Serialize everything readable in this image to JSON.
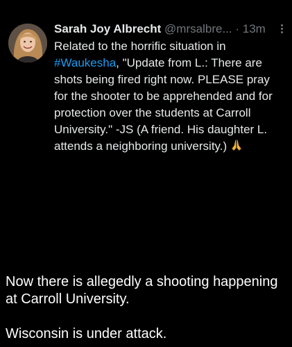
{
  "tweet": {
    "display_name": "Sarah Joy Albrecht",
    "handle": "@mrsalbre...",
    "separator": "·",
    "timestamp": "13m",
    "text_before_hashtag": "Related to the horrific situation in ",
    "hashtag": "#Waukesha",
    "text_after_hashtag": ", \"Update from L.: There are shots being fired right now. PLEASE pray for the shooter to be apprehended and for protection over the students at Carroll University.\" -JS (A friend. His daughter L. attends a neighboring university.) ",
    "emoji_icon": "praying-hands-icon",
    "more_icon": "more-options-icon"
  },
  "caption": {
    "line1": "Now there is allegedly a shooting happening at Carroll University.",
    "line2": "Wisconsin is under attack."
  },
  "colors": {
    "background": "#000000",
    "text_primary": "#e7e9ea",
    "text_secondary": "#71767b",
    "link": "#1d9bf0",
    "caption_text": "#ffffff"
  }
}
